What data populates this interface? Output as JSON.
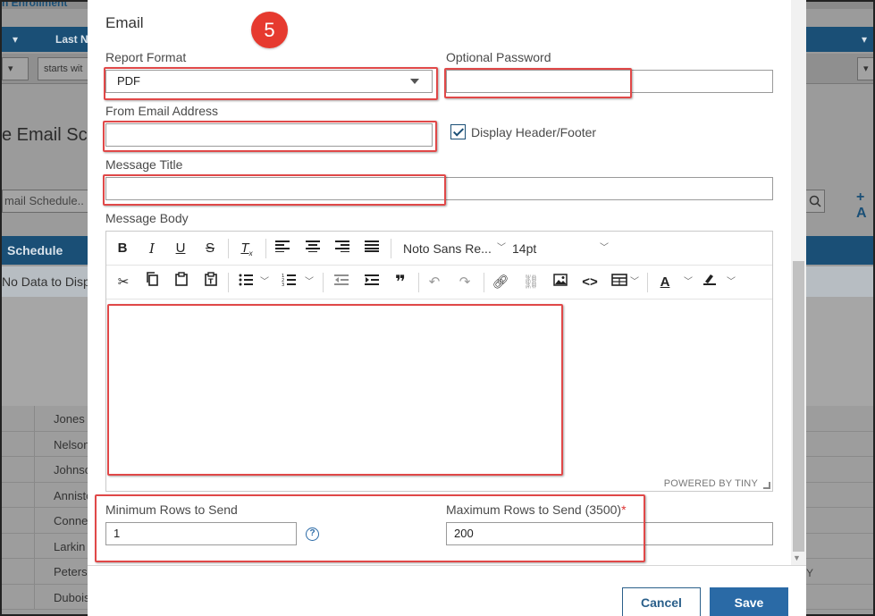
{
  "background": {
    "top_text": "n Enrollment",
    "header_columns": [
      "Last N"
    ],
    "filter_text": "starts wit",
    "page_title": "e Email Sch",
    "search_placeholder": "mail Schedule..",
    "plus_label": "+ A",
    "schedule_header": "Schedule",
    "no_data": "No Data to Disp",
    "rows": [
      "Jones",
      "Nelson",
      "Johnso",
      "Anniston",
      "Conner",
      "Larkin",
      "Peterso",
      "Dubois"
    ],
    "right_char": "Y"
  },
  "modal": {
    "title": "Email",
    "step_number": "5",
    "report_format": {
      "label": "Report Format",
      "value": "PDF"
    },
    "optional_password": {
      "label": "Optional Password",
      "value": ""
    },
    "from_email": {
      "label": "From Email Address",
      "value": ""
    },
    "display_header_footer": {
      "label": "Display Header/Footer",
      "checked": true
    },
    "message_title": {
      "label": "Message Title",
      "value": ""
    },
    "message_body": {
      "label": "Message Body",
      "font_family": "Noto Sans Re...",
      "font_size": "14pt",
      "powered_by": "POWERED BY TINY",
      "content": ""
    },
    "min_rows": {
      "label": "Minimum Rows to Send",
      "value": "1",
      "help_glyph": "?"
    },
    "max_rows": {
      "label": "Maximum Rows to Send (3500)",
      "required_mark": "*",
      "value": "200"
    },
    "buttons": {
      "cancel": "Cancel",
      "save": "Save"
    }
  },
  "colors": {
    "accent": "#2a6aa6",
    "header_bg": "#1a4f76",
    "highlight_red": "#e04848",
    "badge_red": "#e63a2f"
  }
}
